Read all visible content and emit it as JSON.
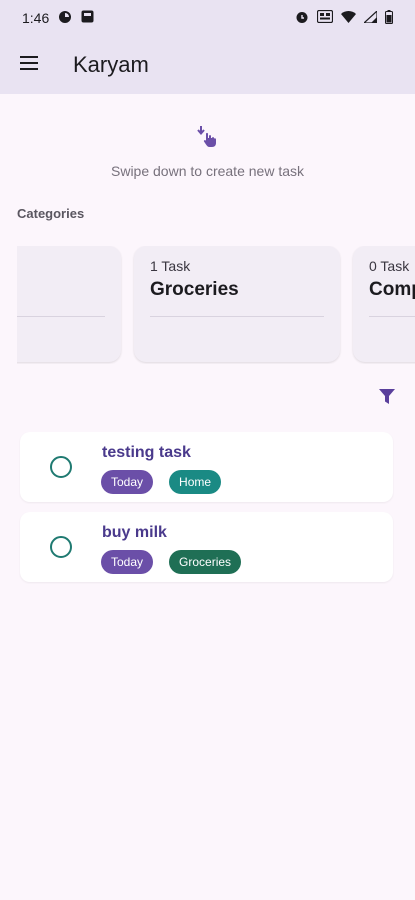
{
  "status_bar": {
    "time": "1:46"
  },
  "app_bar": {
    "title": "Karyam",
    "menu_icon": "hamburger-menu-icon"
  },
  "swipe_hint": {
    "icon": "swipe-down-gesture-icon",
    "text": "Swipe down to create new task"
  },
  "categories": {
    "label": "Categories",
    "items": [
      {
        "count": "",
        "name": ""
      },
      {
        "count": "1 Task",
        "name": "Groceries"
      },
      {
        "count": "0 Task",
        "name": "Comp"
      }
    ]
  },
  "filter": {
    "icon": "filter-icon"
  },
  "tasks": [
    {
      "title": "testing task",
      "chips": [
        "Today",
        "Home"
      ]
    },
    {
      "title": "buy milk",
      "chips": [
        "Today",
        "Groceries"
      ]
    }
  ],
  "colors": {
    "accent": "#6b4fa8",
    "app_bar_bg": "#e9e3f2",
    "page_bg": "#fcf6fc",
    "check_ring": "#1f7a71",
    "chip_home": "#1a8a84",
    "chip_groceries": "#1f6f55"
  }
}
